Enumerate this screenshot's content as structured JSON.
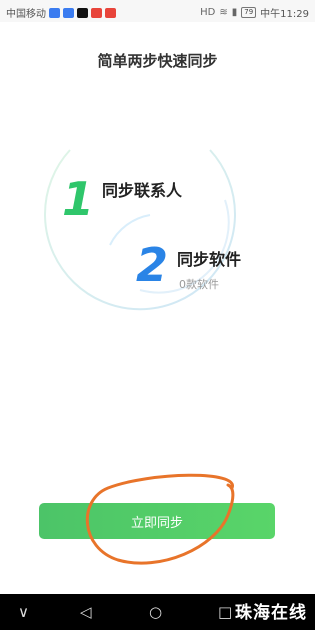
{
  "status_bar": {
    "carrier": "中国移动",
    "time": "中午11:29",
    "battery": "79",
    "network": "HD",
    "app_badges": [
      "#3b7cf0",
      "#3b7cf0",
      "#111111",
      "#e8443a",
      "#e8443a"
    ]
  },
  "page": {
    "title": "简单两步快速同步"
  },
  "steps": [
    {
      "number": "1",
      "label": "同步联系人",
      "color": "#2fc66b"
    },
    {
      "number": "2",
      "label": "同步软件",
      "sub": "0款软件",
      "color": "#2a84e6"
    }
  ],
  "action": {
    "sync_label": "立即同步"
  },
  "nav": {
    "down_icon": "chevron-down-icon",
    "back_icon": "back-triangle-icon",
    "home_icon": "home-circle-icon",
    "recent_icon": "recent-apps-icon"
  },
  "watermark": "珠海在线",
  "colors": {
    "accent_green": "#4cc468",
    "accent_blue": "#2a84e6",
    "annotation_orange": "#e8742a"
  }
}
